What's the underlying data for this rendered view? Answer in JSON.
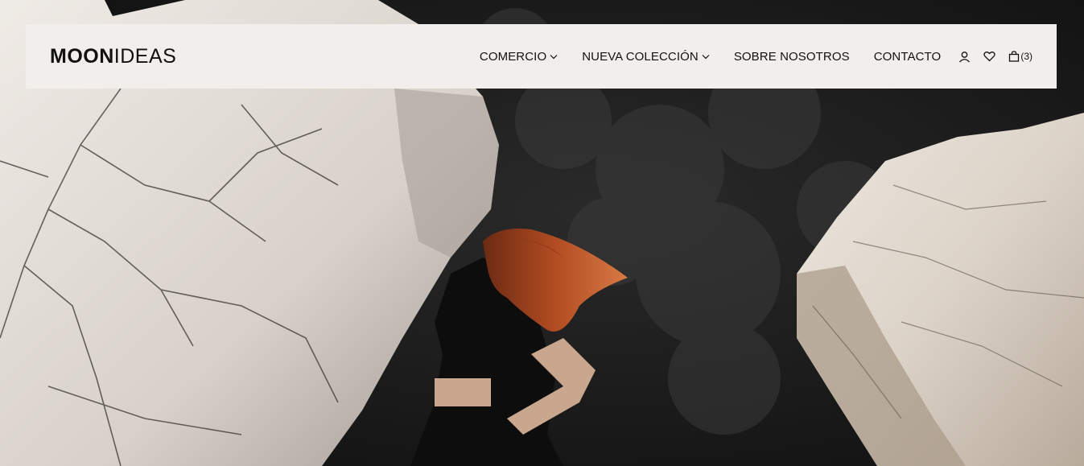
{
  "brand": {
    "logo_bold": "MOON",
    "logo_light": "IDEAS"
  },
  "nav": {
    "items": [
      {
        "label": "COMERCIO",
        "has_dropdown": true
      },
      {
        "label": "NUEVA COLECCIÓN",
        "has_dropdown": true
      },
      {
        "label": "SOBRE NOSOTROS",
        "has_dropdown": false
      },
      {
        "label": "CONTACTO",
        "has_dropdown": false
      }
    ]
  },
  "actions": {
    "account_icon": "user-icon",
    "wishlist_icon": "heart-icon",
    "cart_icon": "shopping-bag-icon",
    "cart_count": "(3)"
  },
  "theme": {
    "header_bg": "#f1eeec",
    "text": "#111111"
  }
}
